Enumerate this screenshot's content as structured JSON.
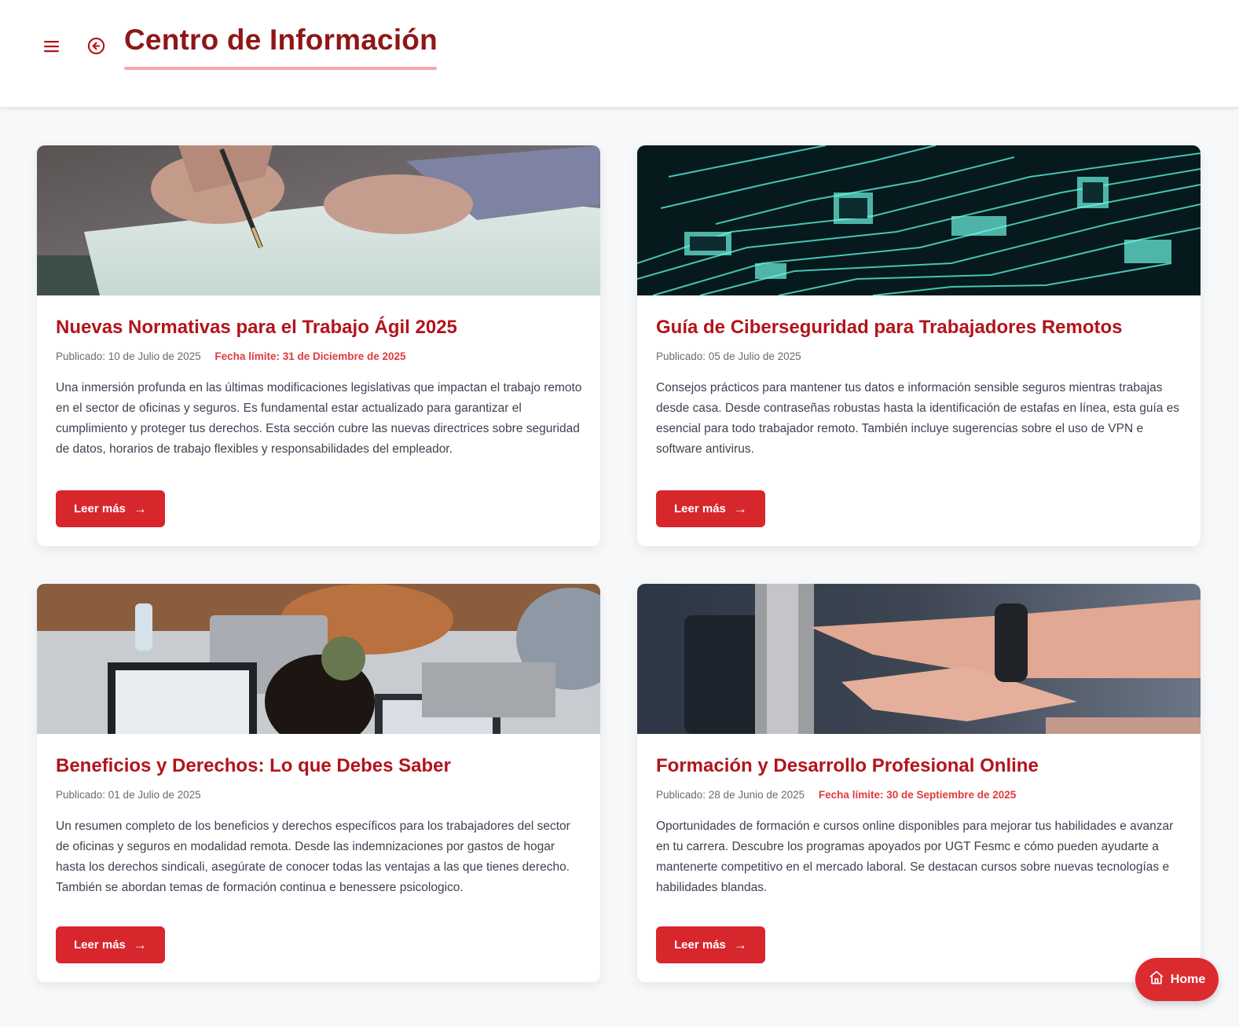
{
  "header": {
    "title": "Centro de Información",
    "menu_icon": "hamburger-menu-icon",
    "back_icon": "circle-arrow-left-icon",
    "accent_color": "#8f1717",
    "underline_color": "#f4a9ad"
  },
  "cards": [
    {
      "title": "Nuevas Normativas para el Trabajo Ágil 2025",
      "published": "Publicado: 10 de Julio de 2025",
      "deadline": "Fecha límite: 31 de Diciembre de 2025",
      "description": "Una inmersión profunda en las últimas modificaciones legislativas que impactan el trabajo remoto en el sector de oficinas y seguros. Es fundamental estar actualizado para garantizar el cumplimiento y proteger tus derechos. Esta sección cubre las nuevas directrices sobre seguridad de datos, horarios de trabajo flexibles y responsabilidades del empleador.",
      "button": "Leer más",
      "image": "photo-hand-signing-document"
    },
    {
      "title": "Guía de Ciberseguridad para Trabajadores Remotos",
      "published": "Publicado: 05 de Julio de 2025",
      "deadline": "",
      "description": "Consejos prácticos para mantener tus datos e información sensible seguros mientras trabajas desde casa. Desde contraseñas robustas hasta la identificación de estafas en línea, esta guía es esencial para todo trabajador remoto. También incluye sugerencias sobre el uso de VPN e software antivirus.",
      "button": "Leer más",
      "image": "photo-circuit-board"
    },
    {
      "title": "Beneficios y Derechos: Lo que Debes Saber",
      "published": "Publicado: 01 de Julio de 2025",
      "deadline": "",
      "description": "Un resumen completo de los beneficios y derechos específicos para los trabajadores del sector de oficinas y seguros en modalidad remota. Desde las indemnizaciones por gastos de hogar hasta los derechos sindicali, asegúrate de conocer todas las ventajas a las que tienes derecho. También se abordan temas de formación continua e benessere psicologico.",
      "button": "Leer más",
      "image": "photo-team-meeting-laptops"
    },
    {
      "title": "Formación y Desarrollo Profesional Online",
      "published": "Publicado: 28 de Junio de 2025",
      "deadline": "Fecha límite: 30 de Septiembre de 2025",
      "description": "Oportunidades de formación e cursos online disponibles para mejorar tus habilidades e avanzar en tu carrera. Descubre los programas apoyados por UGT Fesmc e cómo pueden ayudarte a mantenerte competitivo en el mercado laboral. Se destacan cursos sobre nuevas tecnologías e habilidades blandas.",
      "button": "Leer más",
      "image": "photo-hand-pointing-screen"
    }
  ],
  "home_button": {
    "label": "Home",
    "icon": "home-icon"
  },
  "colors": {
    "button": "#d8262d",
    "card_title": "#b2141b",
    "deadline": "#e03a3e",
    "background": "#f7f8fa"
  }
}
